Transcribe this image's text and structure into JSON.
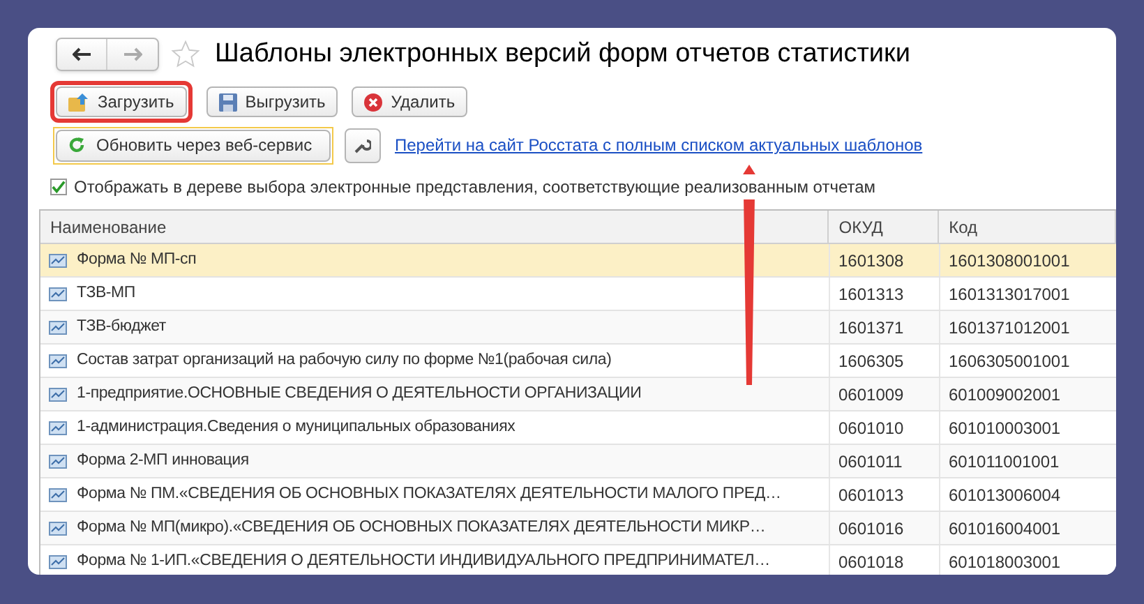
{
  "window": {
    "title": "Шаблоны электронных версий форм отчетов статистики",
    "favorite": false
  },
  "toolbar": {
    "buttons": [
      {
        "label": "Загрузить",
        "kind": "load",
        "highlighted": true
      },
      {
        "label": "Выгрузить",
        "kind": "save",
        "highlighted": false
      },
      {
        "label": "Удалить",
        "kind": "delete",
        "highlighted": false
      }
    ]
  },
  "update_button": {
    "label": "Обновить через веб-сервис"
  },
  "link": {
    "text": "Перейти на сайт Росстата с полным списком актуальных шаблонов"
  },
  "option": {
    "label": "Отображать в дереве выбора электронные представления, соответствующие реализованным отчетам",
    "checked": true
  },
  "table": {
    "columns": [
      "Наименование",
      "ОКУД",
      "Код"
    ],
    "rows": [
      {
        "cells": [
          "Форма № МП-сп",
          "1601308",
          "1601308001001"
        ],
        "selected": true
      },
      {
        "cells": [
          "ТЗВ-МП",
          "1601313",
          "1601313017001"
        ],
        "selected": false
      },
      {
        "cells": [
          "ТЗВ-бюджет",
          "1601371",
          "1601371012001"
        ],
        "selected": false
      },
      {
        "cells": [
          "Состав затрат организаций на рабочую силу по форме №1(рабочая сила)",
          "1606305",
          "1606305001001"
        ],
        "selected": false
      },
      {
        "cells": [
          "1-предприятие.ОСНОВНЫЕ СВЕДЕНИЯ О ДЕЯТЕЛЬНОСТИ ОРГАНИЗАЦИИ",
          "0601009",
          "601009002001"
        ],
        "selected": false
      },
      {
        "cells": [
          "1-администрация.Сведения о муниципальных образованиях",
          "0601010",
          "601010003001"
        ],
        "selected": false
      },
      {
        "cells": [
          "Форма 2-МП инновация",
          "0601011",
          "601011001001"
        ],
        "selected": false
      },
      {
        "cells": [
          "Форма № ПМ.«СВЕДЕНИЯ ОБ ОСНОВНЫХ ПОКАЗАТЕЛЯХ ДЕЯТЕЛЬНОСТИ МАЛОГО ПРЕД…",
          "0601013",
          "601013006004"
        ],
        "selected": false
      },
      {
        "cells": [
          "Форма № МП(микро).«СВЕДЕНИЯ ОБ ОСНОВНЫХ ПОКАЗАТЕЛЯХ ДЕЯТЕЛЬНОСТИ МИКР…",
          "0601016",
          "601016004001"
        ],
        "selected": false
      },
      {
        "cells": [
          "Форма № 1-ИП.«СВЕДЕНИЯ О ДЕЯТЕЛЬНОСТИ ИНДИВИДУАЛЬНОГО ПРЕДПРИНИМАТЕЛ…",
          "0601018",
          "601018003001"
        ],
        "selected": false
      }
    ]
  }
}
